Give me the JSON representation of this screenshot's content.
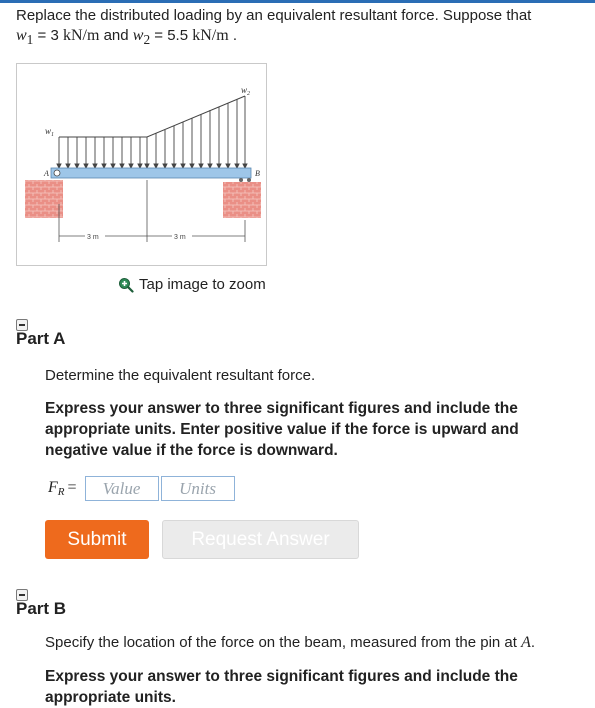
{
  "prompt": {
    "line1": "Replace the distributed loading by an equivalent resultant force. Suppose that",
    "w1_var": "w",
    "w1_sub": "1",
    "w1_eq": " = 3 ",
    "w1_unit": "kN/m",
    "and_text": " and ",
    "w2_var": "w",
    "w2_sub": "2",
    "w2_eq": " = 5.5 ",
    "w2_unit": "kN/m",
    "end": " ."
  },
  "figure": {
    "label_w1": "w",
    "label_w1_sub": "1",
    "label_w2": "w",
    "label_w2_sub": "2",
    "label_a": "A",
    "label_b": "B",
    "dim_left": "3 m",
    "dim_right": "3 m"
  },
  "zoom": {
    "label": "Tap image to zoom",
    "icon": "zoom-in-icon"
  },
  "part_a": {
    "title": "Part A",
    "question": "Determine the equivalent resultant force.",
    "instruction": "Express your answer to three significant figures and include the appropriate units. Enter positive value if the force is upward and negative value if the force is downward.",
    "answer_var": "F",
    "answer_sub": "R",
    "answer_eq": "=",
    "value_placeholder": "Value",
    "units_placeholder": "Units",
    "submit_label": "Submit",
    "request_label": "Request Answer"
  },
  "part_b": {
    "title": "Part B",
    "question_prefix": "Specify the location of the force on the beam, measured from the pin at ",
    "question_var": "A",
    "question_end": ".",
    "instruction": "Express your answer to three significant figures and include the appropriate units."
  },
  "colors": {
    "accent_rule": "#2a6db5",
    "submit_bg": "#ee6a1d",
    "beam": "#9ec6e8",
    "support": "#e8837a"
  }
}
